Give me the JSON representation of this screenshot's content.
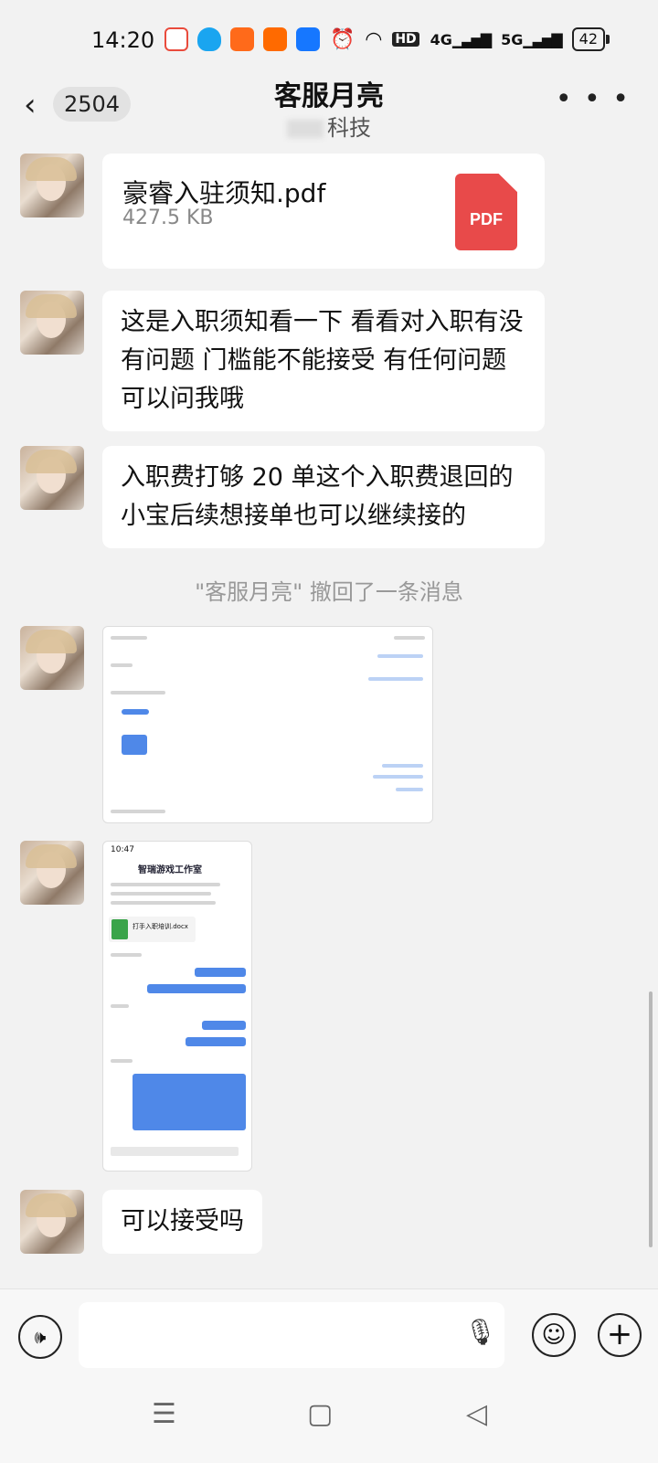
{
  "status": {
    "time": "14:20",
    "network_hd": "HD",
    "net_4g": "4G",
    "net_5g": "5G",
    "battery": "42",
    "app_icon_colors": [
      "#e94b3c",
      "#1aa5f0",
      "#ff6a1a",
      "#ff6a00",
      "#1677ff"
    ]
  },
  "header": {
    "back_count": "2504",
    "title": "客服月亮",
    "subtitle": "科技"
  },
  "messages": {
    "file": {
      "name": "豪睿入驻须知.pdf",
      "size": "427.5 KB",
      "icon_label": "PDF"
    },
    "text1": "这是入职须知看一下 看看对入职有没有问题 门槛能不能接受 有任何问题可以问我哦",
    "text2": "入职费打够 20 单这个入职费退回的 小宝后续想接单也可以继续接的",
    "system": "\"客服月亮\" 撤回了一条消息",
    "screenshot2": {
      "time": "10:47",
      "contact": "智瑞游戏工作室",
      "doc_name": "打手入职培训.docx"
    },
    "text3": "可以接受吗"
  },
  "input": {
    "placeholder": ""
  },
  "icons": {
    "back": "back-arrow-icon",
    "more": "more-icon",
    "pdf": "pdf-file-icon",
    "voice": "voice-icon",
    "mic": "microphone-icon",
    "emoji": "emoji-icon",
    "plus": "plus-icon"
  },
  "colors": {
    "background": "#f2f2f2",
    "bubble": "#ffffff",
    "pdf_red": "#e84a4a",
    "chat_blue": "#4f88e8"
  }
}
